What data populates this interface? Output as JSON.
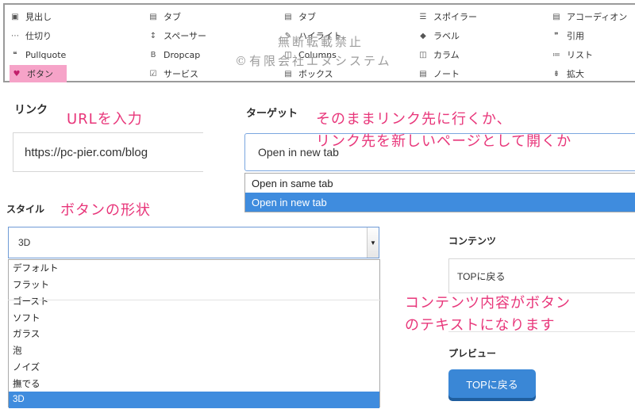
{
  "menu": {
    "items": [
      {
        "icon": "▣",
        "icon_name": "heading-icon",
        "label": "見出し"
      },
      {
        "icon": "▤",
        "icon_name": "tabs-icon",
        "label": "タブ"
      },
      {
        "icon": "▤",
        "icon_name": "tabs-icon",
        "label": "タブ"
      },
      {
        "icon": "☰",
        "icon_name": "spoiler-icon",
        "label": "スポイラー"
      },
      {
        "icon": "▤",
        "icon_name": "accordion-icon",
        "label": "アコーディオン"
      },
      {
        "icon": "⋯",
        "icon_name": "divider-icon",
        "label": "仕切り"
      },
      {
        "icon": "↕",
        "icon_name": "spacer-icon",
        "label": "スペーサー"
      },
      {
        "icon": "✎",
        "icon_name": "highlight-icon",
        "label": "ハイライト"
      },
      {
        "icon": "◆",
        "icon_name": "label-icon",
        "label": "ラベル"
      },
      {
        "icon": "❞",
        "icon_name": "quote-icon",
        "label": "引用"
      },
      {
        "icon": "❝",
        "icon_name": "pullquote-icon",
        "label": "Pullquote"
      },
      {
        "icon": "B",
        "icon_name": "dropcap-icon",
        "label": "Dropcap"
      },
      {
        "icon": "◫",
        "icon_name": "columns-icon",
        "label": "Columns"
      },
      {
        "icon": "◫",
        "icon_name": "column-icon",
        "label": "カラム"
      },
      {
        "icon": "≔",
        "icon_name": "list-icon",
        "label": "リスト"
      },
      {
        "icon": "♥",
        "icon_name": "heart-icon",
        "label": "ボタン",
        "active": true
      },
      {
        "icon": "☑",
        "icon_name": "service-icon",
        "label": "サービス"
      },
      {
        "icon": "▤",
        "icon_name": "box-icon",
        "label": "ボックス"
      },
      {
        "icon": "▤",
        "icon_name": "note-icon",
        "label": "ノート"
      },
      {
        "icon": "⇟",
        "icon_name": "expand-icon",
        "label": "拡大"
      }
    ]
  },
  "watermark": {
    "line1": "無断転載禁止",
    "line2": "©有限会社エヌシステム"
  },
  "link": {
    "label": "リンク",
    "value": "https://pc-pier.com/blog"
  },
  "target": {
    "label": "ターゲット",
    "selected": "Open in new tab",
    "options": [
      "Open in same tab",
      "Open in new tab"
    ],
    "selected_index": 1
  },
  "style": {
    "label": "スタイル",
    "selected": "3D",
    "options": [
      "デフォルト",
      "フラット",
      "ゴースト",
      "ソフト",
      "ガラス",
      "泡",
      "ノイズ",
      "撫でる",
      "3D"
    ],
    "selected_index": 8
  },
  "content": {
    "label": "コンテンツ",
    "value": "TOPに戻る"
  },
  "preview": {
    "label": "プレビュー",
    "button_text": "TOPに戻る"
  },
  "annotations": {
    "url": "URLを入力",
    "target_line1": "そのままリンク先に行くか、",
    "target_line2": "リンク先を新しいページとして開くか",
    "style": "ボタンの形状",
    "content_line1": "コンテンツ内容がボタン",
    "content_line2": "のテキストになります"
  },
  "colors": {
    "accent": "#3a87d6",
    "selected_option": "#3f8cde",
    "annotation": "#e8367a",
    "active_menu": "#f6a3c8"
  }
}
